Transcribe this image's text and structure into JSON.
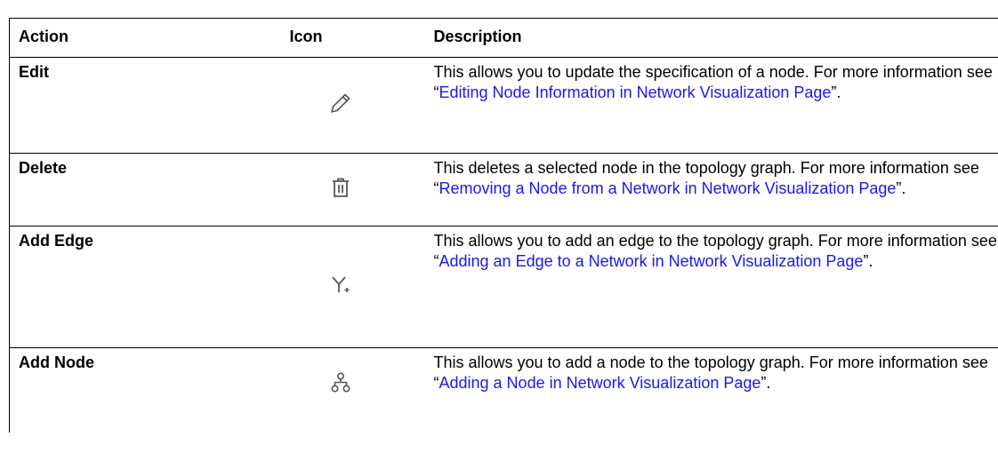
{
  "headers": {
    "action": "Action",
    "icon": "Icon",
    "description": "Description"
  },
  "rows": [
    {
      "action": "Edit",
      "icon": "pencil-icon",
      "desc_before": "This allows you to update the specification of a node. For more information see “",
      "link": "Editing Node Information in Network Visualization Page",
      "desc_after": "”."
    },
    {
      "action": "Delete",
      "icon": "trash-icon",
      "desc_before": "This deletes a selected node in the topology graph. For more information see “",
      "link": "Removing a Node from a Network in Network Visualization Page",
      "desc_after": "”."
    },
    {
      "action": "Add Edge",
      "icon": "add-edge-icon",
      "desc_before": "This allows you to add an edge to the topology graph. For more information see “",
      "link": "Adding an Edge to a Network in Network Visualization Page",
      "desc_after": "”."
    },
    {
      "action": "Add Node",
      "icon": "add-node-icon",
      "desc_before": "This allows you to add a node to the topology graph. For more information see “",
      "link": "Adding a Node in Network Visualization Page",
      "desc_after": "”."
    }
  ],
  "colors": {
    "link": "#1a1ae0",
    "icon": "#555555",
    "border": "#000000"
  }
}
